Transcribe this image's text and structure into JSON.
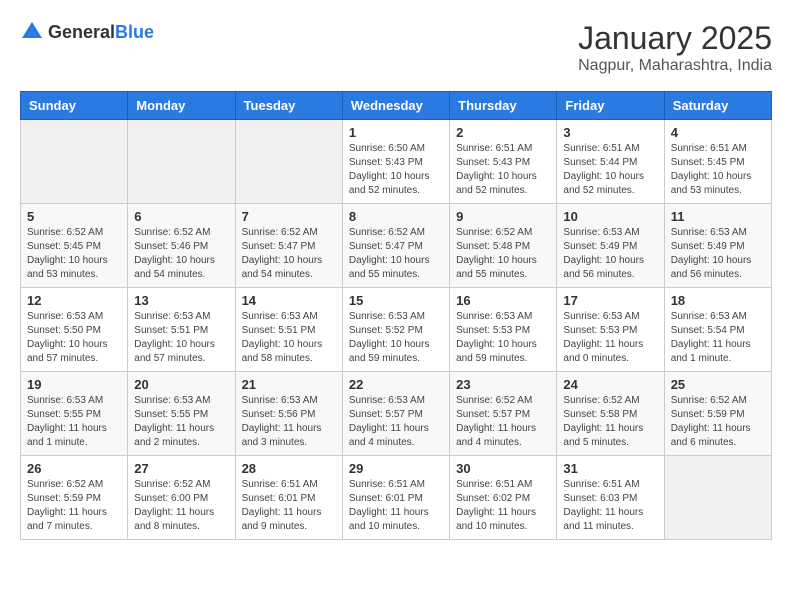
{
  "header": {
    "logo_general": "General",
    "logo_blue": "Blue",
    "month_year": "January 2025",
    "location": "Nagpur, Maharashtra, India"
  },
  "weekdays": [
    "Sunday",
    "Monday",
    "Tuesday",
    "Wednesday",
    "Thursday",
    "Friday",
    "Saturday"
  ],
  "weeks": [
    [
      {
        "day": "",
        "info": ""
      },
      {
        "day": "",
        "info": ""
      },
      {
        "day": "",
        "info": ""
      },
      {
        "day": "1",
        "info": "Sunrise: 6:50 AM\nSunset: 5:43 PM\nDaylight: 10 hours\nand 52 minutes."
      },
      {
        "day": "2",
        "info": "Sunrise: 6:51 AM\nSunset: 5:43 PM\nDaylight: 10 hours\nand 52 minutes."
      },
      {
        "day": "3",
        "info": "Sunrise: 6:51 AM\nSunset: 5:44 PM\nDaylight: 10 hours\nand 52 minutes."
      },
      {
        "day": "4",
        "info": "Sunrise: 6:51 AM\nSunset: 5:45 PM\nDaylight: 10 hours\nand 53 minutes."
      }
    ],
    [
      {
        "day": "5",
        "info": "Sunrise: 6:52 AM\nSunset: 5:45 PM\nDaylight: 10 hours\nand 53 minutes."
      },
      {
        "day": "6",
        "info": "Sunrise: 6:52 AM\nSunset: 5:46 PM\nDaylight: 10 hours\nand 54 minutes."
      },
      {
        "day": "7",
        "info": "Sunrise: 6:52 AM\nSunset: 5:47 PM\nDaylight: 10 hours\nand 54 minutes."
      },
      {
        "day": "8",
        "info": "Sunrise: 6:52 AM\nSunset: 5:47 PM\nDaylight: 10 hours\nand 55 minutes."
      },
      {
        "day": "9",
        "info": "Sunrise: 6:52 AM\nSunset: 5:48 PM\nDaylight: 10 hours\nand 55 minutes."
      },
      {
        "day": "10",
        "info": "Sunrise: 6:53 AM\nSunset: 5:49 PM\nDaylight: 10 hours\nand 56 minutes."
      },
      {
        "day": "11",
        "info": "Sunrise: 6:53 AM\nSunset: 5:49 PM\nDaylight: 10 hours\nand 56 minutes."
      }
    ],
    [
      {
        "day": "12",
        "info": "Sunrise: 6:53 AM\nSunset: 5:50 PM\nDaylight: 10 hours\nand 57 minutes."
      },
      {
        "day": "13",
        "info": "Sunrise: 6:53 AM\nSunset: 5:51 PM\nDaylight: 10 hours\nand 57 minutes."
      },
      {
        "day": "14",
        "info": "Sunrise: 6:53 AM\nSunset: 5:51 PM\nDaylight: 10 hours\nand 58 minutes."
      },
      {
        "day": "15",
        "info": "Sunrise: 6:53 AM\nSunset: 5:52 PM\nDaylight: 10 hours\nand 59 minutes."
      },
      {
        "day": "16",
        "info": "Sunrise: 6:53 AM\nSunset: 5:53 PM\nDaylight: 10 hours\nand 59 minutes."
      },
      {
        "day": "17",
        "info": "Sunrise: 6:53 AM\nSunset: 5:53 PM\nDaylight: 11 hours\nand 0 minutes."
      },
      {
        "day": "18",
        "info": "Sunrise: 6:53 AM\nSunset: 5:54 PM\nDaylight: 11 hours\nand 1 minute."
      }
    ],
    [
      {
        "day": "19",
        "info": "Sunrise: 6:53 AM\nSunset: 5:55 PM\nDaylight: 11 hours\nand 1 minute."
      },
      {
        "day": "20",
        "info": "Sunrise: 6:53 AM\nSunset: 5:55 PM\nDaylight: 11 hours\nand 2 minutes."
      },
      {
        "day": "21",
        "info": "Sunrise: 6:53 AM\nSunset: 5:56 PM\nDaylight: 11 hours\nand 3 minutes."
      },
      {
        "day": "22",
        "info": "Sunrise: 6:53 AM\nSunset: 5:57 PM\nDaylight: 11 hours\nand 4 minutes."
      },
      {
        "day": "23",
        "info": "Sunrise: 6:52 AM\nSunset: 5:57 PM\nDaylight: 11 hours\nand 4 minutes."
      },
      {
        "day": "24",
        "info": "Sunrise: 6:52 AM\nSunset: 5:58 PM\nDaylight: 11 hours\nand 5 minutes."
      },
      {
        "day": "25",
        "info": "Sunrise: 6:52 AM\nSunset: 5:59 PM\nDaylight: 11 hours\nand 6 minutes."
      }
    ],
    [
      {
        "day": "26",
        "info": "Sunrise: 6:52 AM\nSunset: 5:59 PM\nDaylight: 11 hours\nand 7 minutes."
      },
      {
        "day": "27",
        "info": "Sunrise: 6:52 AM\nSunset: 6:00 PM\nDaylight: 11 hours\nand 8 minutes."
      },
      {
        "day": "28",
        "info": "Sunrise: 6:51 AM\nSunset: 6:01 PM\nDaylight: 11 hours\nand 9 minutes."
      },
      {
        "day": "29",
        "info": "Sunrise: 6:51 AM\nSunset: 6:01 PM\nDaylight: 11 hours\nand 10 minutes."
      },
      {
        "day": "30",
        "info": "Sunrise: 6:51 AM\nSunset: 6:02 PM\nDaylight: 11 hours\nand 10 minutes."
      },
      {
        "day": "31",
        "info": "Sunrise: 6:51 AM\nSunset: 6:03 PM\nDaylight: 11 hours\nand 11 minutes."
      },
      {
        "day": "",
        "info": ""
      }
    ]
  ]
}
